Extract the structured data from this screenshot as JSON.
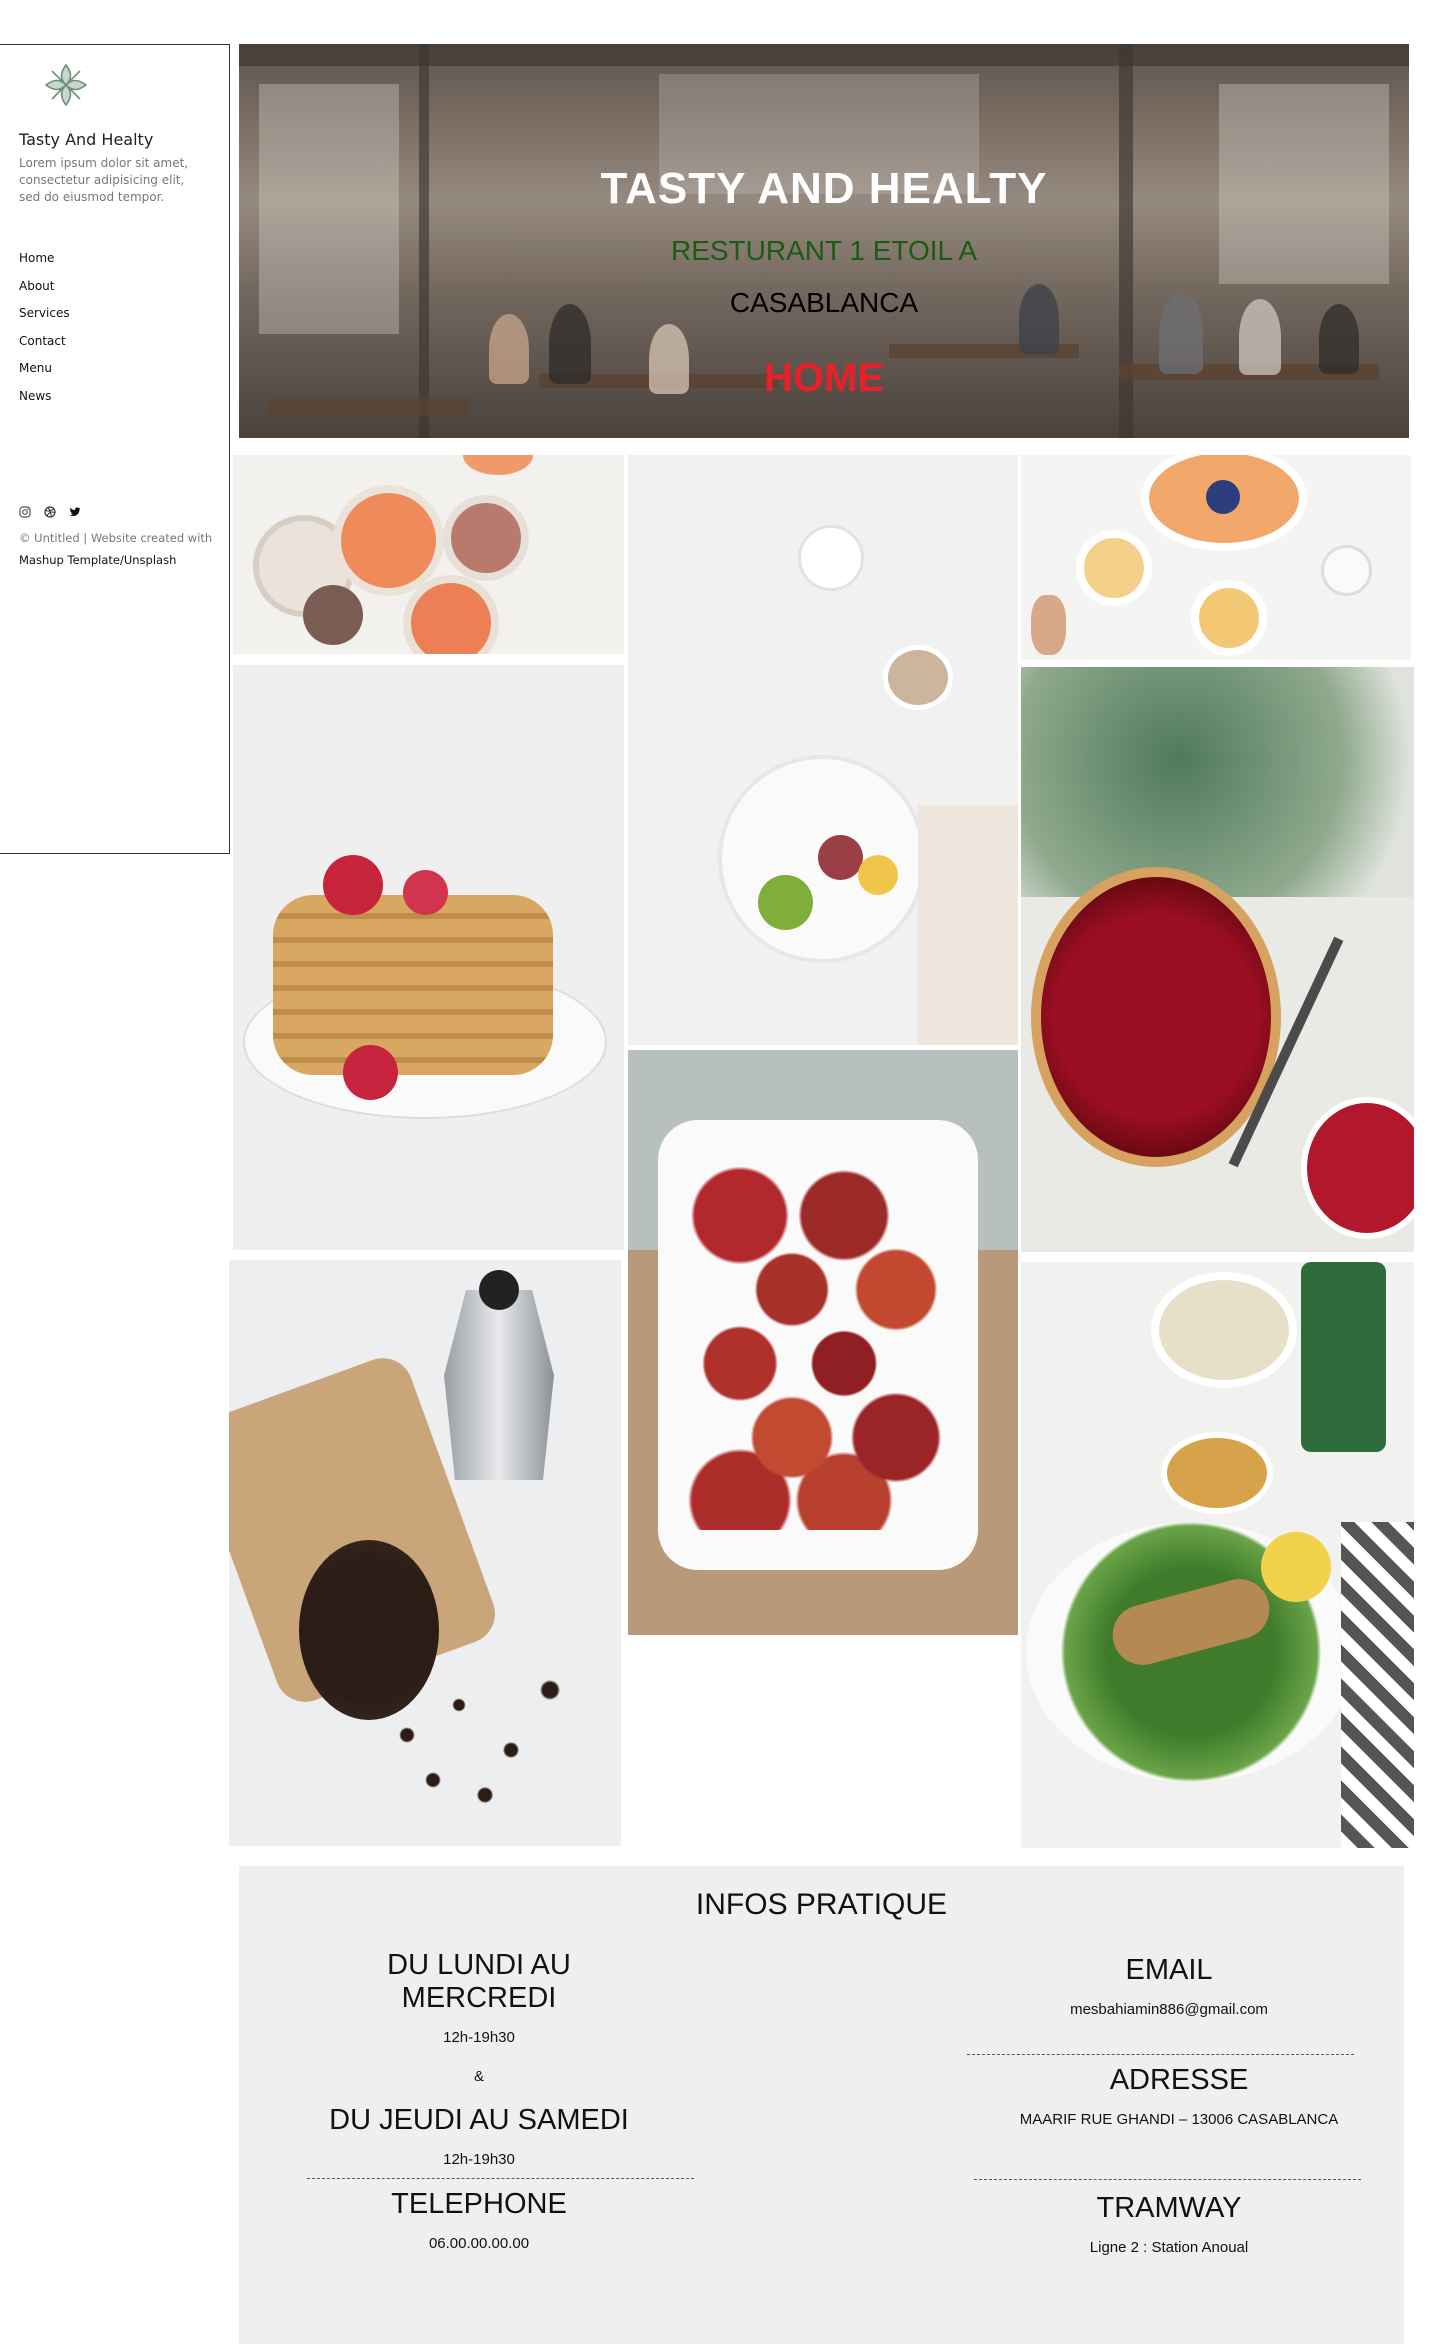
{
  "sidebar": {
    "logo_icon": "leaf-logo-icon",
    "title": "Tasty And Healty",
    "description": "Lorem ipsum dolor sit amet, consectetur adipisicing elit, sed do eiusmod tempor.",
    "nav": [
      "Home",
      "About",
      "Services",
      "Contact",
      "Menu",
      "News"
    ],
    "social": [
      "instagram-icon",
      "dribbble-icon",
      "twitter-icon"
    ],
    "copyright": "© Untitled | Website created with",
    "credit": "Mashup Template/Unsplash"
  },
  "hero": {
    "title": "TASTY AND HEALTY",
    "subtitle": "RESTURANT 1 ETOIL A",
    "city": "CASABLANCA",
    "home_link": "HOME",
    "title_color": "#ffffff",
    "subtitle_color": "#1d5a12",
    "home_color": "#e8202b"
  },
  "gallery": [
    "figs-and-grapefruit-plates",
    "yogurt-bowl-with-fruit",
    "breakfast-table-with-berries",
    "pancake-stack-with-raspberries",
    "berry-tart-with-leaves",
    "moka-pot-and-coffee-beans",
    "roasted-plums-in-dish",
    "fish-salad-with-lemon"
  ],
  "infos": {
    "heading": "INFOS PRATIQUE",
    "left": {
      "days1": "DU LUNDI AU MERCREDI",
      "hours1": "12h-19h30",
      "and": "&",
      "days2": "DU JEUDI AU SAMEDI",
      "hours2": "12h-19h30",
      "phone_label": "TELEPHONE",
      "phone": "06.00.00.00.00"
    },
    "right": {
      "email_label": "EMAIL",
      "email": "mesbahiamin886@gmail.com",
      "address_label": "ADRESSE",
      "address": "MAARIF RUE GHANDI – 13006 CASABLANCA",
      "tram_label": "TRAMWAY",
      "tram": "Ligne 2 : Station Anoual"
    }
  }
}
